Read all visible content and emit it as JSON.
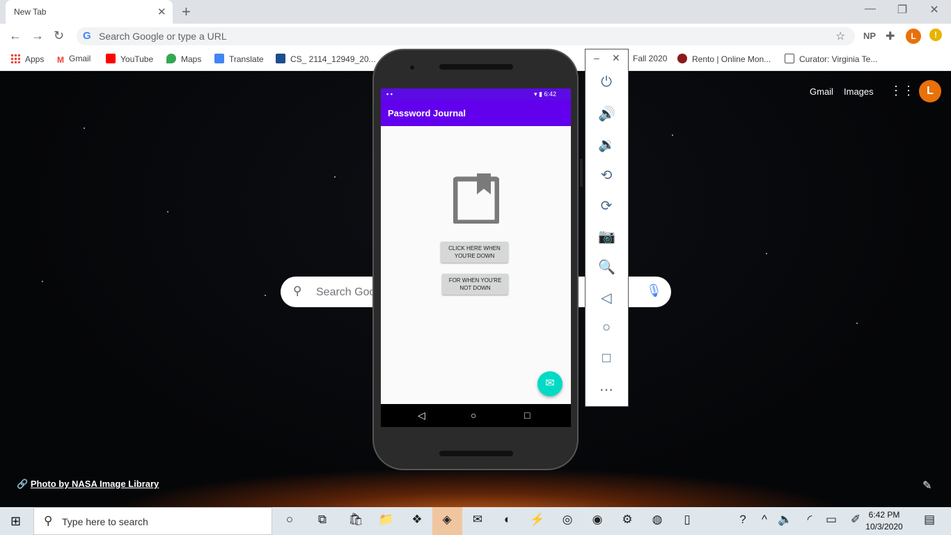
{
  "browser": {
    "tab_title": "New Tab",
    "tab_close": "✕",
    "new_tab": "+",
    "omnibox_placeholder": "Search Google or type a URL",
    "extension_label": "NP",
    "profile_initial": "L",
    "alert_icon": "!",
    "bookmarks": [
      {
        "label": "Apps",
        "color": "#4285f4"
      },
      {
        "label": "Gmail",
        "color": "#ea4335"
      },
      {
        "label": "YouTube",
        "color": "#ff0000"
      },
      {
        "label": "Maps",
        "color": "#34a853"
      },
      {
        "label": "Translate",
        "color": "#4285f4"
      },
      {
        "label": "CS_ 2114_12949_20...",
        "color": "#1b4d8f"
      },
      {
        "label": "Fall 2020",
        "color": "#ffffff"
      },
      {
        "label": "Rento | Online Mon...",
        "color": "#8b1a1a"
      },
      {
        "label": "Curator: Virginia Te...",
        "color": "#555555"
      }
    ]
  },
  "newtab": {
    "gmail_link": "Gmail",
    "images_link": "Images",
    "profile_initial": "L",
    "search_placeholder": "Search Google or type a URL",
    "search_visible_text": "Search Goo",
    "photo_credit": "Photo by NASA Image Library"
  },
  "emulator": {
    "status_time": "6:42",
    "app_title": "Password Journal",
    "button_down": "CLICK HERE WHEN YOU'RE DOWN",
    "button_not_down": "FOR WHEN YOU'RE NOT DOWN",
    "panel_icons": [
      "power-icon",
      "volume-up-icon",
      "volume-down-icon",
      "rotate-left-icon",
      "rotate-right-icon",
      "camera-icon",
      "zoom-icon",
      "back-icon",
      "home-icon",
      "overview-icon",
      "more-icon"
    ]
  },
  "taskbar": {
    "search_placeholder": "Type here to search",
    "time": "6:42 PM",
    "date": "10/3/2020"
  },
  "colors": {
    "app_primary": "#6200ee",
    "app_status": "#5c0be4",
    "fab": "#03dac5",
    "profile": "#e8710a"
  }
}
